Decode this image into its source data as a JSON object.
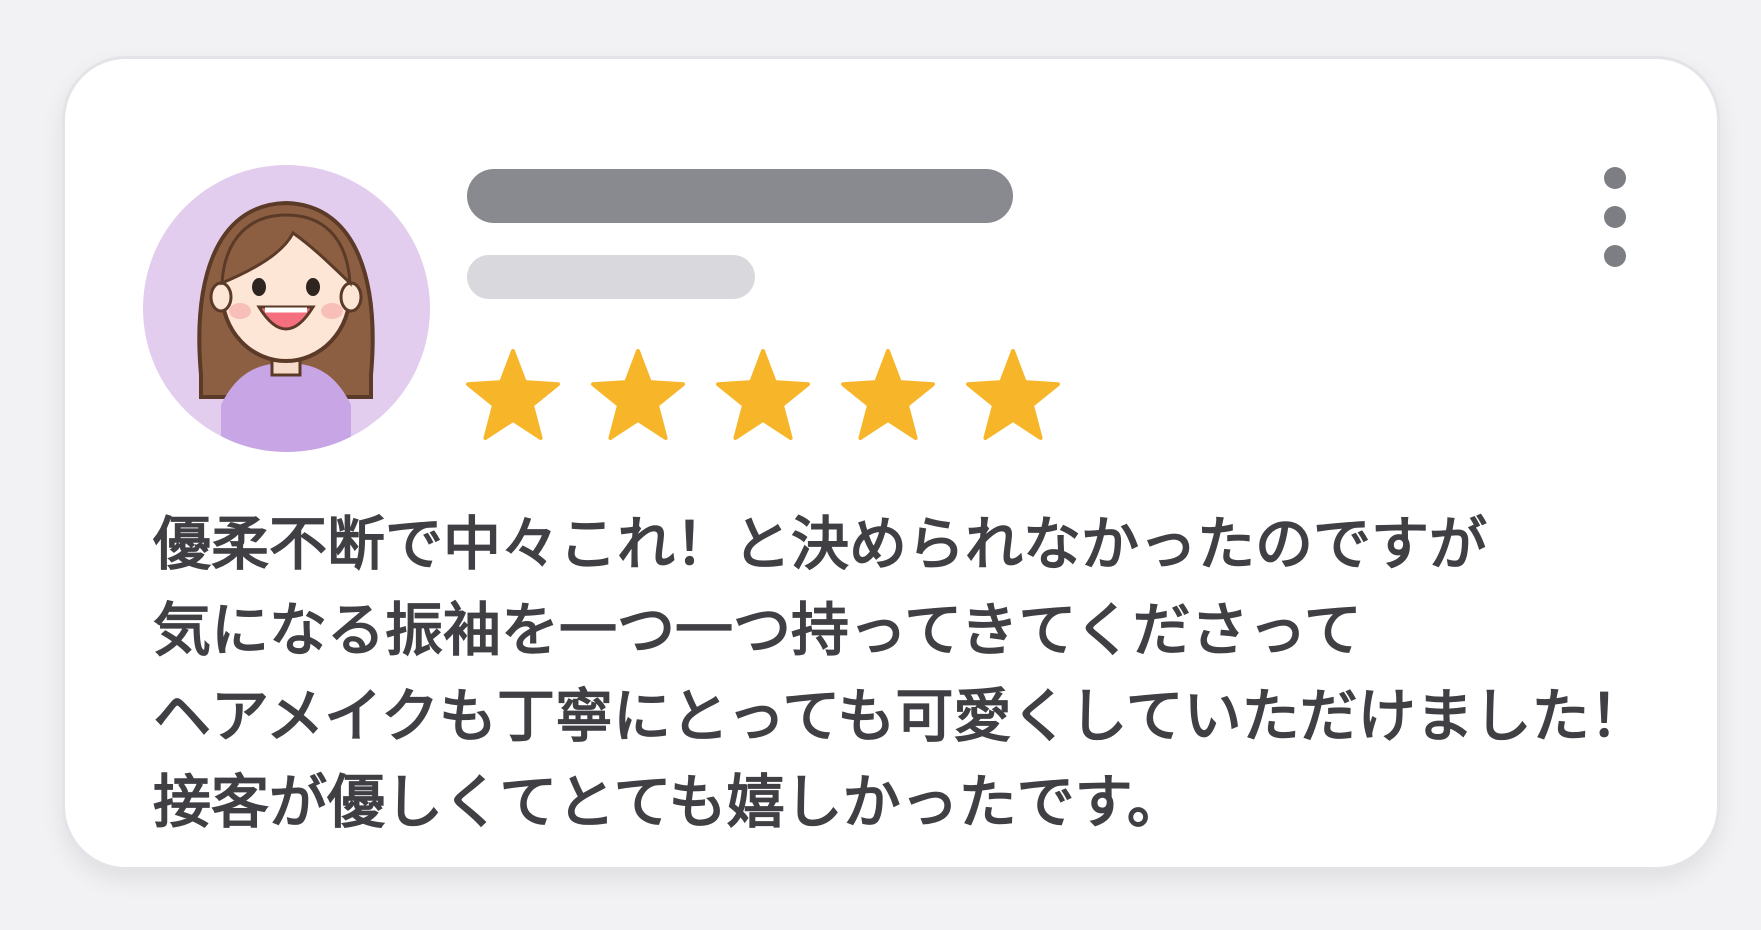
{
  "review": {
    "rating": 5,
    "rating_max": 5,
    "lines": [
      "優柔不断で中々これ！と決められなかったのですが",
      "気になる振袖を一つ一つ持ってきてくださって",
      "ヘアメイクも丁寧にとっても可愛くしていただけました！",
      "接客が優しくてとても嬉しかったです。"
    ]
  },
  "icons": {
    "avatar": "smiling-woman-avatar",
    "menu": "more-vertical-icon",
    "star": "star-icon"
  },
  "colors": {
    "star": "#f7b52a",
    "avatar_bg": "#e3cdee",
    "name_placeholder": "#898a8f",
    "date_placeholder": "#d9d9dd",
    "text": "#3f3f44"
  }
}
